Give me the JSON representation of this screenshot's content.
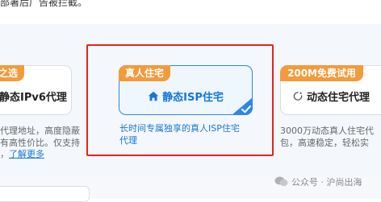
{
  "top_note": "部署后广告被拦截。",
  "cards": [
    {
      "badge": "之选",
      "title": "静态IPv6代理",
      "desc_lines": [
        "代理地址，高度隐蔽",
        "有高性价比。仅支持"
      ],
      "more_label": "了解更多",
      "selected": false
    },
    {
      "badge": "真人住宅",
      "title": "静态ISP住宅",
      "icon": "home-icon",
      "desc_lines": [
        "长时间专属独享的真人ISP住宅",
        "代理"
      ],
      "selected": true,
      "accent_color": "#1677d8"
    },
    {
      "badge": "200M免费试用",
      "title": "动态住宅代理",
      "icon": "refresh-icon",
      "desc_lines": [
        "3000万动态真人住宅代",
        "包，高速稳定，轻松实"
      ],
      "selected": false
    }
  ],
  "watermark": "公众号 · 沪尚出海",
  "colors": {
    "badge": "#f39a3b",
    "selected_border": "#2e86e8",
    "highlight": "#e3241b"
  }
}
